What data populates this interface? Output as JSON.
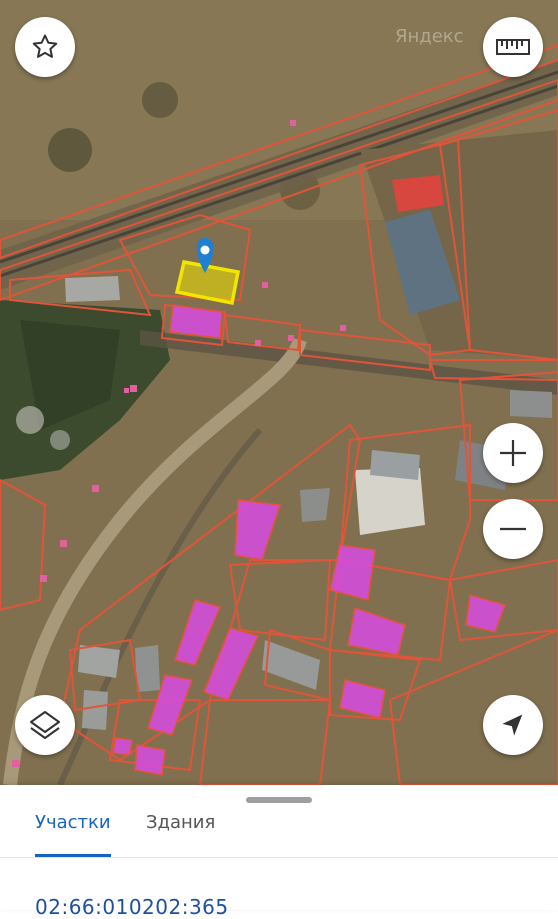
{
  "map": {
    "watermark": "Яндекс",
    "selected_parcel_color": "#f2e600",
    "building_color": "#d84ae0",
    "boundary_color": "#e0553a"
  },
  "controls": {
    "favorite": "star-icon",
    "ruler": "ruler-icon",
    "zoom_in": "plus-icon",
    "zoom_out": "minus-icon",
    "layers": "layers-icon",
    "locate": "navigation-arrow-icon"
  },
  "bottom_sheet": {
    "tabs": [
      {
        "label": "Участки",
        "active": true
      },
      {
        "label": "Здания",
        "active": false
      }
    ],
    "parcel_number": "02:66:010202:365",
    "accent_color": "#1565c0"
  }
}
